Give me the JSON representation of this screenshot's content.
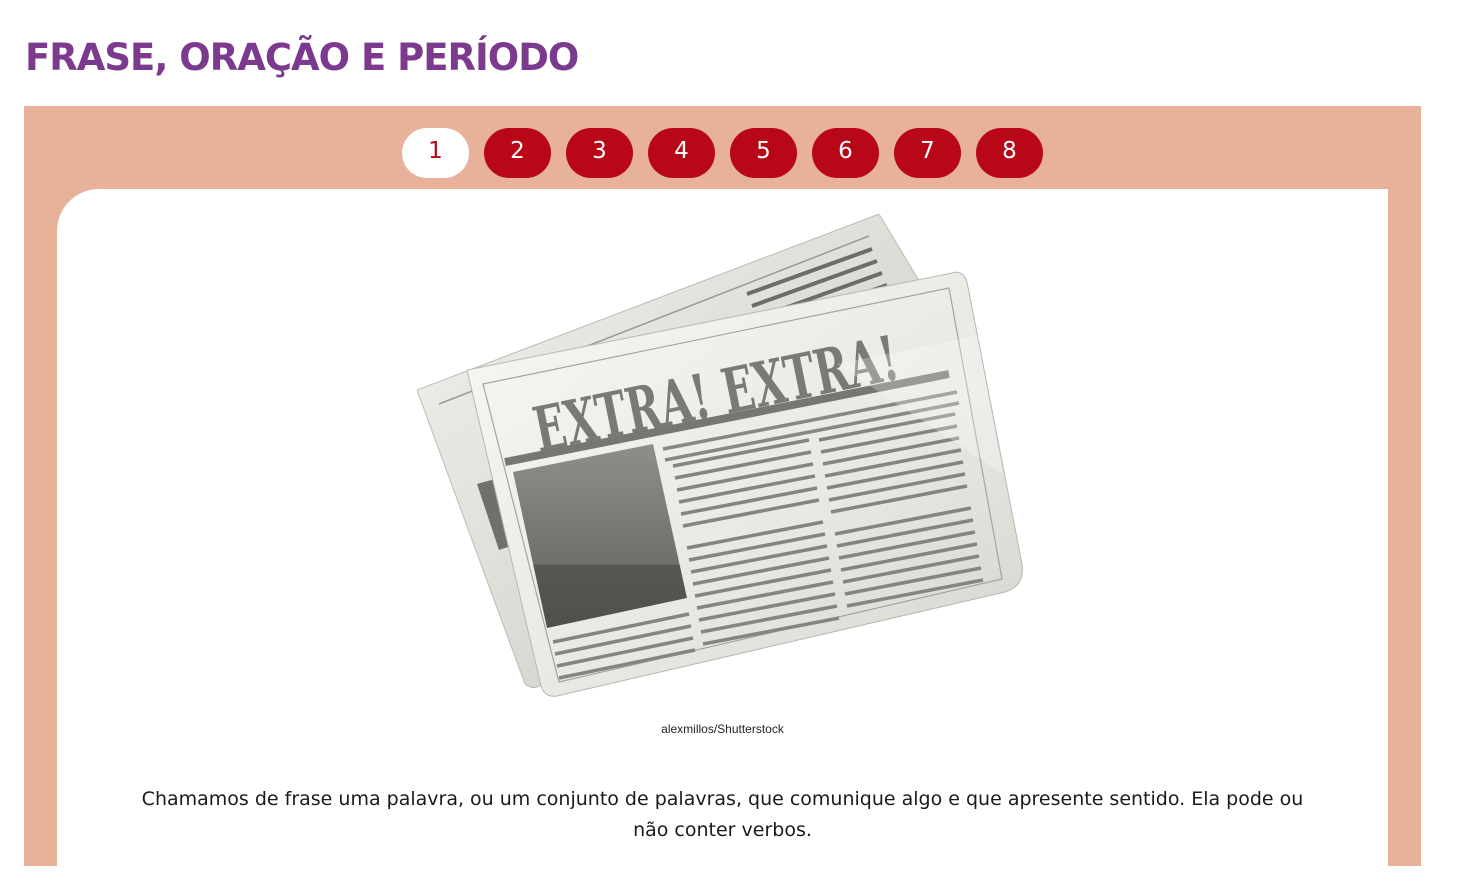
{
  "header": {
    "title": "FRASE, ORAÇÃO E PERÍODO"
  },
  "pager": {
    "active_page": 1,
    "pages": [
      "1",
      "2",
      "3",
      "4",
      "5",
      "6",
      "7",
      "8"
    ]
  },
  "figure": {
    "headline": "EXTRA! EXTRA!",
    "credit": "alexmillos/Shutterstock"
  },
  "content": {
    "paragraph": "Chamamos de frase uma palavra, ou um conjunto de palavras, que comunique algo e que apresente sentido. Ela pode ou não conter verbos."
  },
  "colors": {
    "title": "#7b3a8e",
    "panel": "#e7b19a",
    "pager_button": "#b80818"
  }
}
